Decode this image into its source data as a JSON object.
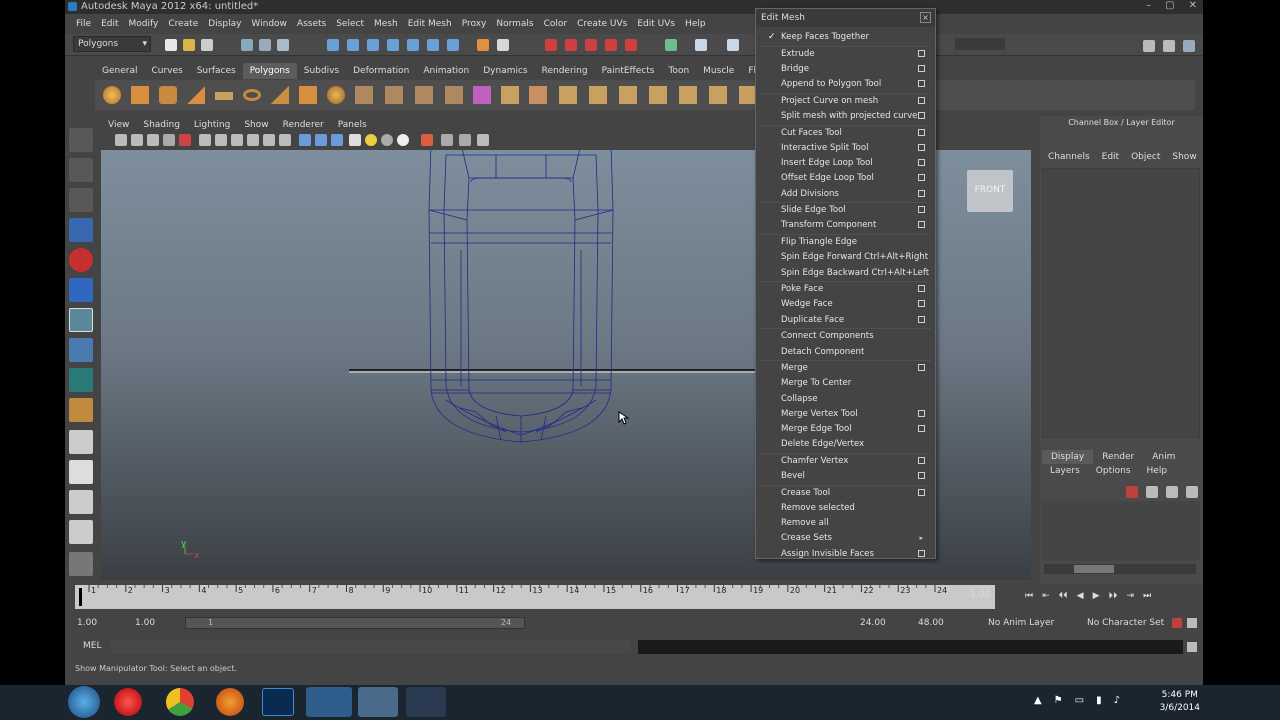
{
  "window": {
    "title": "Autodesk Maya 2012 x64: untitled*",
    "controls": [
      "–",
      "▢",
      "✕"
    ]
  },
  "menubar": [
    "File",
    "Edit",
    "Modify",
    "Create",
    "Display",
    "Window",
    "Assets",
    "Select",
    "Mesh",
    "Edit Mesh",
    "Proxy",
    "Normals",
    "Color",
    "Create UVs",
    "Edit UVs",
    "Help"
  ],
  "status": {
    "menuset": "Polygons"
  },
  "shelf": {
    "tabs": [
      "General",
      "Curves",
      "Surfaces",
      "Polygons",
      "Subdivs",
      "Deformation",
      "Animation",
      "Dynamics",
      "Rendering",
      "PaintEffects",
      "Toon",
      "Muscle",
      "Fluids"
    ],
    "active": "Polygons"
  },
  "panel": {
    "menu": [
      "View",
      "Shading",
      "Lighting",
      "Show",
      "Renderer",
      "Panels"
    ]
  },
  "viewport": {
    "viewcube": "FRONT",
    "axis_y": "y",
    "axis_x": "x"
  },
  "channelbox": {
    "title": "Channel Box / Layer Editor",
    "menu": [
      "Channels",
      "Edit",
      "Object",
      "Show"
    ],
    "layer_tabs": [
      "Display",
      "Render",
      "Anim"
    ],
    "layer_menu": [
      "Layers",
      "Options",
      "Help"
    ]
  },
  "timeline": {
    "ticks": [
      "1",
      "2",
      "3",
      "4",
      "5",
      "6",
      "7",
      "8",
      "9",
      "10",
      "11",
      "12",
      "13",
      "14",
      "15",
      "16",
      "17",
      "18",
      "19",
      "20",
      "21",
      "22",
      "23",
      "24"
    ],
    "current": "1.00"
  },
  "range": {
    "start": "1.00",
    "inner_start": "1.00",
    "slider_start": "1",
    "slider_end": "24",
    "end1": "24.00",
    "end2": "48.00",
    "anim_layer": "No Anim Layer",
    "char_set": "No Character Set"
  },
  "cmd": {
    "label": "MEL"
  },
  "helpline": "Show Manipulator Tool: Select an object.",
  "editmesh": {
    "title": "Edit Mesh",
    "items": [
      {
        "label": "Keep Faces Together",
        "check": true
      },
      {
        "label": "Extrude",
        "box": true
      },
      {
        "label": "Bridge",
        "box": true
      },
      {
        "label": "Append to Polygon Tool",
        "box": true
      },
      {
        "label": "Project Curve on mesh",
        "box": true
      },
      {
        "label": "Split mesh with projected curve",
        "box": true
      },
      {
        "label": "Cut Faces Tool",
        "box": true
      },
      {
        "label": "Interactive Split Tool",
        "box": true
      },
      {
        "label": "Insert Edge Loop Tool",
        "box": true
      },
      {
        "label": "Offset Edge Loop Tool",
        "box": true
      },
      {
        "label": "Add Divisions",
        "box": true
      },
      {
        "label": "Slide Edge Tool",
        "box": true
      },
      {
        "label": "Transform Component",
        "box": true
      },
      {
        "label": "Flip Triangle Edge"
      },
      {
        "label": "Spin Edge Forward  Ctrl+Alt+Right"
      },
      {
        "label": "Spin Edge Backward  Ctrl+Alt+Left"
      },
      {
        "label": "Poke Face",
        "box": true
      },
      {
        "label": "Wedge Face",
        "box": true
      },
      {
        "label": "Duplicate Face",
        "box": true
      },
      {
        "label": "Connect Components"
      },
      {
        "label": "Detach Component"
      },
      {
        "label": "Merge",
        "box": true
      },
      {
        "label": "Merge To Center"
      },
      {
        "label": "Collapse"
      },
      {
        "label": "Merge Vertex Tool",
        "box": true
      },
      {
        "label": "Merge Edge Tool",
        "box": true
      },
      {
        "label": "Delete Edge/Vertex"
      },
      {
        "label": "Chamfer Vertex",
        "box": true
      },
      {
        "label": "Bevel",
        "box": true
      },
      {
        "label": "Crease Tool",
        "box": true
      },
      {
        "label": "Remove selected"
      },
      {
        "label": "Remove all"
      },
      {
        "label": "Crease Sets",
        "arrow": true
      },
      {
        "label": "Assign Invisible Faces",
        "box": true
      }
    ]
  },
  "taskbar": {
    "time": "5:46 PM",
    "date": "3/6/2014"
  },
  "colors": {
    "wire": "#1e2a8a",
    "maya_bg": "#444444",
    "taskbar": "#1b2530"
  }
}
